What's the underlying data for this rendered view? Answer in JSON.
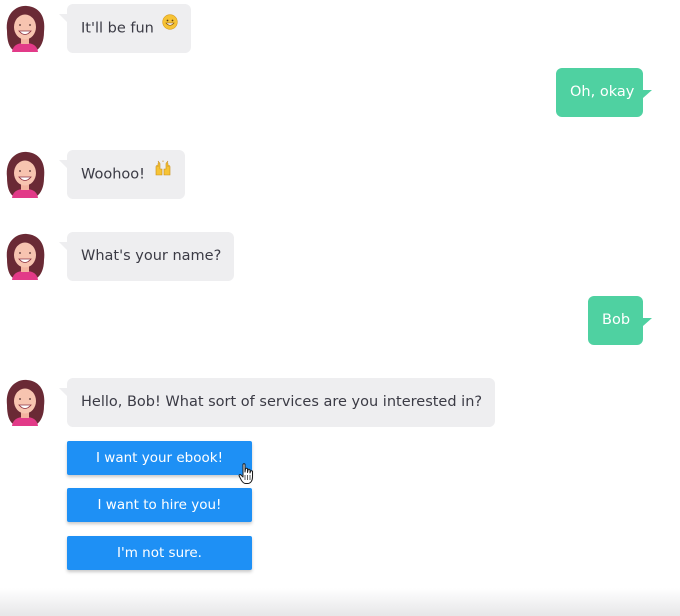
{
  "conversation": {
    "messages": [
      {
        "sender": "bot",
        "text": "It'll be fun",
        "emoji": "grinning-face-emoji"
      },
      {
        "sender": "user",
        "text": "Oh, okay"
      },
      {
        "sender": "bot",
        "text": "Woohoo!",
        "emoji": "raising-hands-emoji"
      },
      {
        "sender": "bot",
        "text": "What's your name?"
      },
      {
        "sender": "user",
        "text": "Bob"
      },
      {
        "sender": "bot",
        "text": "Hello, Bob! What sort of services are you interested in?"
      }
    ],
    "choices": [
      {
        "label": "I want your ebook!"
      },
      {
        "label": "I want to hire you!"
      },
      {
        "label": "I'm not sure."
      }
    ]
  },
  "colors": {
    "bot_bubble": "#eeeef0",
    "user_bubble": "#4fd1a1",
    "choice_button": "#1e90f5"
  }
}
